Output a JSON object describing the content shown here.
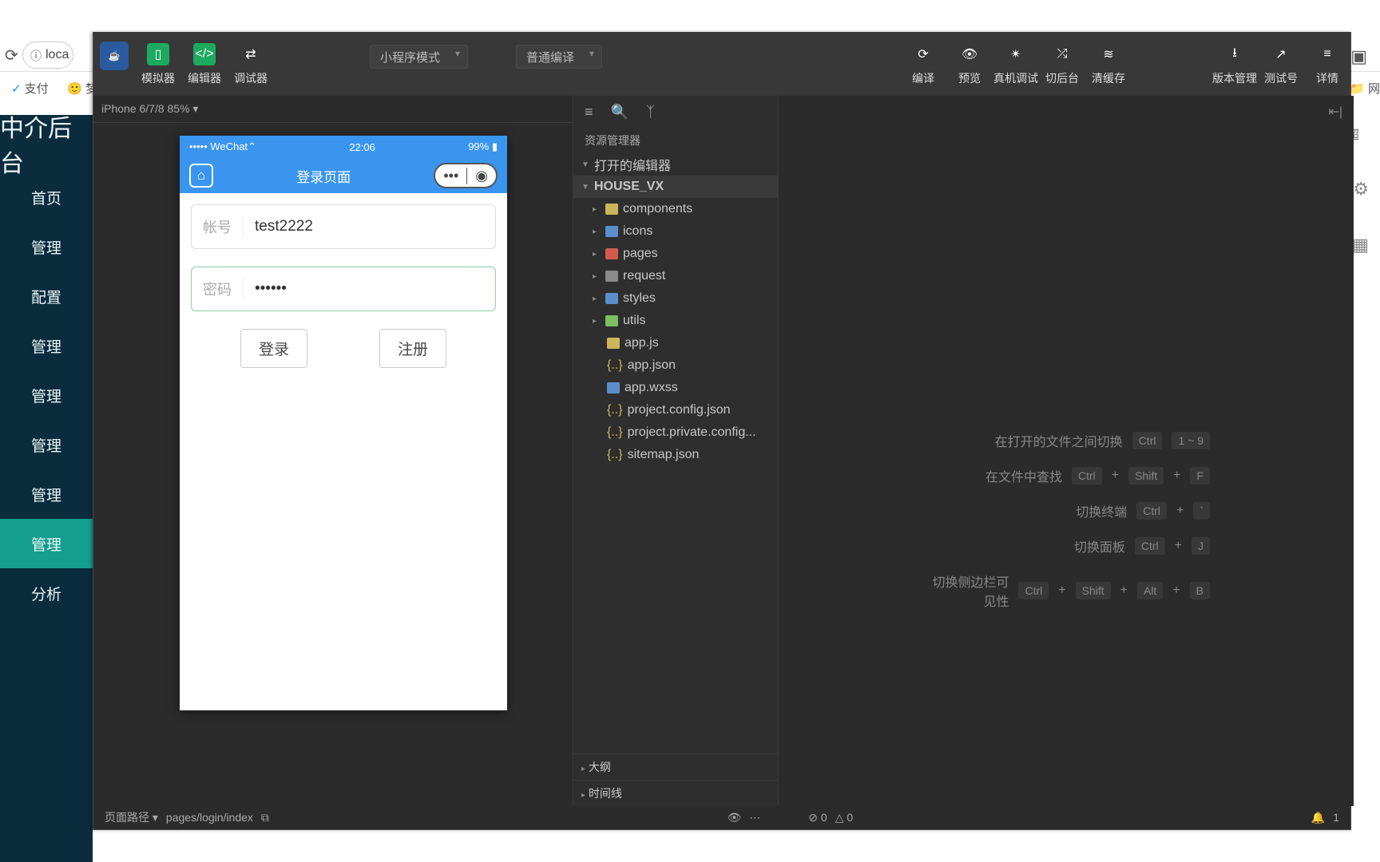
{
  "browser": {
    "url": "loca",
    "bookmark_pay": "支付",
    "bookmark_other": "梦"
  },
  "admin": {
    "title": "中介后台",
    "items": [
      "首页",
      "管理",
      "配置",
      "管理",
      "管理",
      "管理",
      "管理",
      "管理",
      "分析"
    ],
    "active_index": 7,
    "user_badge": "超"
  },
  "titlebar": {
    "buttons": {
      "simulator": "模拟器",
      "editor": "编辑器",
      "debugger": "调试器"
    },
    "mode": "小程序模式",
    "compile_mode": "普通编译",
    "right": {
      "compile": "编译",
      "preview": "预览",
      "realdebug": "真机调试",
      "bgswitch": "切后台",
      "clearcache": "清缓存",
      "version": "版本管理",
      "testid": "测试号",
      "detail": "详情"
    }
  },
  "device": {
    "label": "iPhone 6/7/8 85%"
  },
  "phone": {
    "carrier": "••••• WeChat",
    "signal": "⌃",
    "time": "22:06",
    "battery": "99%",
    "pagetitle": "登录页面",
    "account": {
      "label": "帐号",
      "value": "test2222"
    },
    "password": {
      "label": "密码",
      "value": "••••••"
    },
    "login": "登录",
    "register": "注册"
  },
  "explorer": {
    "title": "资源管理器",
    "open_editors": "打开的编辑器",
    "project": "HOUSE_VX",
    "folders": [
      "components",
      "icons",
      "pages",
      "request",
      "styles",
      "utils"
    ],
    "files": [
      "app.js",
      "app.json",
      "app.wxss",
      "project.config.json",
      "project.private.config...",
      "sitemap.json"
    ],
    "outline": "大纲",
    "timeline": "时间线"
  },
  "shortcuts": {
    "switch_files": {
      "label": "在打开的文件之间切换",
      "k1": "Ctrl",
      "k2": "1 ~ 9"
    },
    "find": {
      "label": "在文件中查找",
      "k1": "Ctrl",
      "k2": "Shift",
      "k3": "F"
    },
    "terminal": {
      "label": "切换终端",
      "k1": "Ctrl",
      "k2": "`"
    },
    "panel": {
      "label": "切换面板",
      "k1": "Ctrl",
      "k2": "J"
    },
    "sidebar": {
      "label": "切换侧边栏可见性",
      "k1": "Ctrl",
      "k2": "Shift",
      "k3": "Alt",
      "k4": "B"
    }
  },
  "statusbar": {
    "path_label": "页面路径",
    "path": "pages/login/index",
    "errs": "0",
    "warns": "0",
    "col": "1",
    "network": "网"
  }
}
